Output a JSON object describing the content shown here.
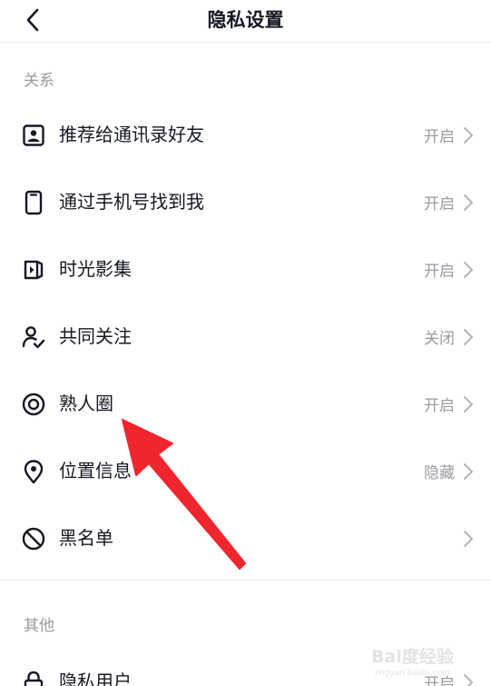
{
  "header": {
    "title": "隐私设置"
  },
  "sections": [
    {
      "title": "关系",
      "items": [
        {
          "label": "推荐给通讯录好友",
          "value": "开启",
          "icon": "contact-card-icon"
        },
        {
          "label": "通过手机号找到我",
          "value": "开启",
          "icon": "phone-icon"
        },
        {
          "label": "时光影集",
          "value": "开启",
          "icon": "album-icon"
        },
        {
          "label": "共同关注",
          "value": "关闭",
          "icon": "user-check-icon"
        },
        {
          "label": "熟人圈",
          "value": "开启",
          "icon": "target-circle-icon"
        },
        {
          "label": "位置信息",
          "value": "隐藏",
          "icon": "location-pin-icon"
        },
        {
          "label": "黑名单",
          "value": "",
          "icon": "block-icon"
        }
      ]
    },
    {
      "title": "其他",
      "items": [
        {
          "label": "隐私用户",
          "value": "开启",
          "icon": "lock-icon"
        }
      ]
    }
  ],
  "colors": {
    "primary_text": "#161823",
    "secondary_text": "#9a9ba0",
    "divider": "#ececec",
    "annotation_arrow": "#f0262e"
  },
  "watermark": {
    "text": "Bai度经验",
    "subtext": "jingyan.baidu.com"
  }
}
